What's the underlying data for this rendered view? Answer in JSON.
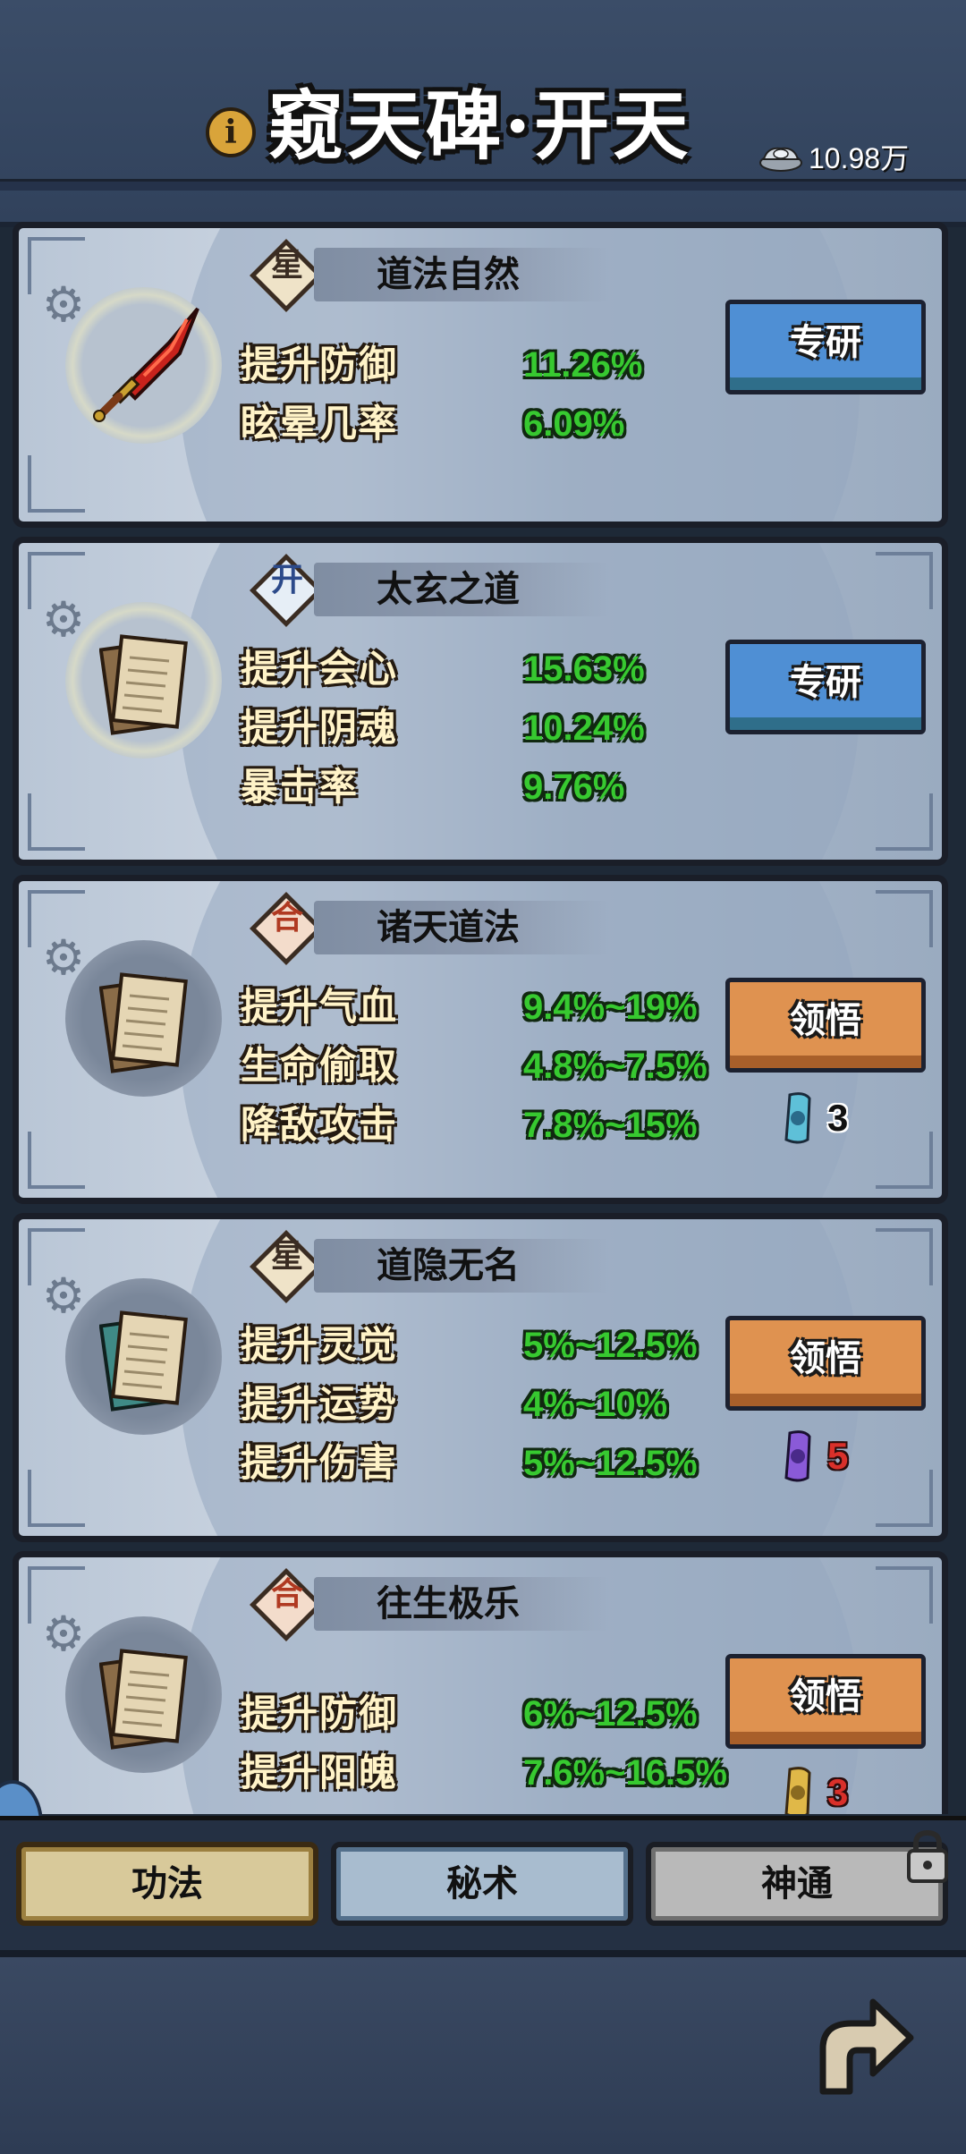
{
  "header": {
    "title": "窥天碑·开天",
    "info_symbol": "i",
    "currency_icon": "silver-ingot-icon",
    "currency_amount": "10.98万"
  },
  "cards": [
    {
      "badge": "星",
      "skill": "道法自然",
      "item_icon": "red-sword-icon",
      "stats": [
        {
          "label": "提升防御",
          "value": "11.26%"
        },
        {
          "label": "眩晕几率",
          "value": "6.09%"
        }
      ],
      "button": "专研"
    },
    {
      "badge": "开",
      "skill": "太玄之道",
      "item_icon": "scroll-icon",
      "stats": [
        {
          "label": "提升会心",
          "value": "15.63%"
        },
        {
          "label": "提升阴魂",
          "value": "10.24%"
        },
        {
          "label": "暴击率",
          "value": "9.76%"
        }
      ],
      "button": "专研"
    },
    {
      "badge": "合",
      "skill": "诸天道法",
      "item_icon": "scroll-icon",
      "stats": [
        {
          "label": "提升气血",
          "value": "9.4%~19%"
        },
        {
          "label": "生命偷取",
          "value": "4.8%~7.5%"
        },
        {
          "label": "降敌攻击",
          "value": "7.8%~15%"
        }
      ],
      "button": "领悟",
      "cost_icon": "blue-scroll-icon",
      "cost": "3"
    },
    {
      "badge": "星",
      "skill": "道隐无名",
      "item_icon": "scroll-icon",
      "stats": [
        {
          "label": "提升灵觉",
          "value": "5%~12.5%"
        },
        {
          "label": "提升运势",
          "value": "4%~10%"
        },
        {
          "label": "提升伤害",
          "value": "5%~12.5%"
        }
      ],
      "button": "领悟",
      "cost_icon": "purple-scroll-icon",
      "cost": "5"
    },
    {
      "badge": "合",
      "skill": "往生极乐",
      "item_icon": "scroll-icon",
      "stats": [
        {
          "label": "提升防御",
          "value": "6%~12.5%"
        },
        {
          "label": "提升阳魄",
          "value": "7.6%~16.5%"
        }
      ],
      "button": "领悟",
      "cost_icon": "gold-scroll-icon",
      "cost": "3"
    }
  ],
  "tabs": [
    "功法",
    "秘术",
    "神通"
  ],
  "colors": {
    "stat_green": "#37c930",
    "button_blue": "#4f8fd4",
    "button_orange": "#df9250",
    "cost_red": "#d9302a"
  }
}
